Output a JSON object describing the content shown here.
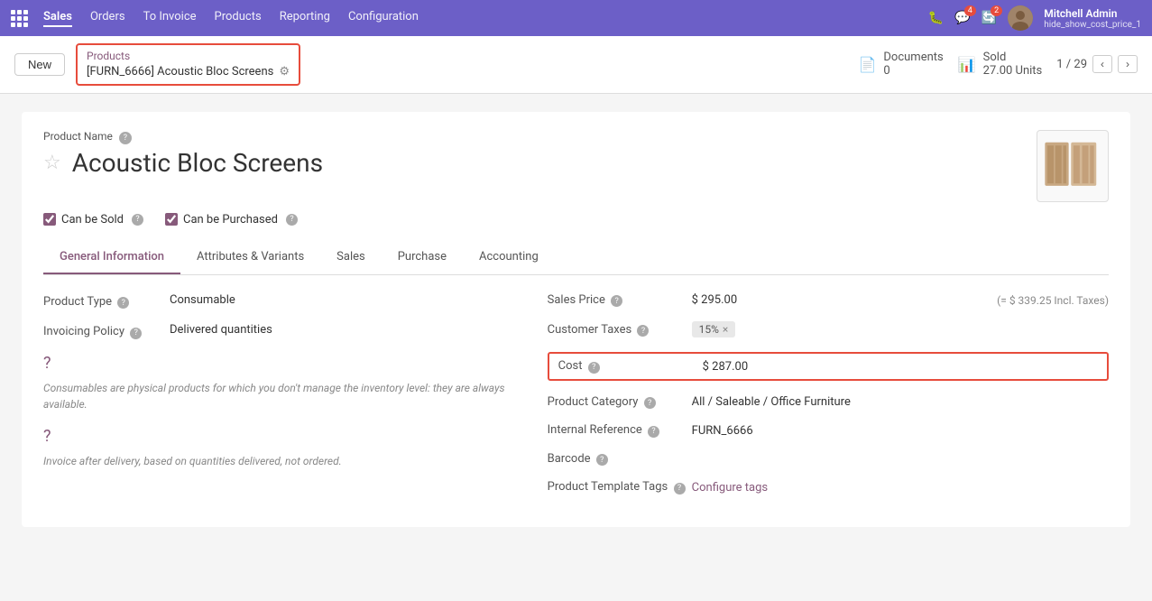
{
  "app": {
    "title": "Odoo"
  },
  "topnav": {
    "menu_items": [
      {
        "id": "sales",
        "label": "Sales",
        "active": true
      },
      {
        "id": "orders",
        "label": "Orders",
        "active": false
      },
      {
        "id": "to_invoice",
        "label": "To Invoice",
        "active": false
      },
      {
        "id": "products",
        "label": "Products",
        "active": false
      },
      {
        "id": "reporting",
        "label": "Reporting",
        "active": false
      },
      {
        "id": "configuration",
        "label": "Configuration",
        "active": false
      }
    ],
    "notifications_count": "4",
    "activities_count": "2",
    "user_name": "Mitchell Admin",
    "user_sub": "hide_show_cost_price_1"
  },
  "subheader": {
    "new_label": "New",
    "breadcrumb_parent": "Products",
    "breadcrumb_current": "[FURN_6666] Acoustic Bloc Screens",
    "documents_label": "Documents",
    "documents_count": "0",
    "sold_label": "Sold",
    "sold_value": "27.00 Units",
    "pagination": "1 / 29"
  },
  "product": {
    "name_label": "Product Name",
    "title": "Acoustic Bloc Screens",
    "can_be_sold": true,
    "can_be_sold_label": "Can be Sold",
    "can_be_purchased": true,
    "can_be_purchased_label": "Can be Purchased"
  },
  "tabs": [
    {
      "id": "general",
      "label": "General Information",
      "active": true
    },
    {
      "id": "attributes",
      "label": "Attributes & Variants",
      "active": false
    },
    {
      "id": "sales",
      "label": "Sales",
      "active": false
    },
    {
      "id": "purchase",
      "label": "Purchase",
      "active": false
    },
    {
      "id": "accounting",
      "label": "Accounting",
      "active": false
    }
  ],
  "general_info": {
    "left": {
      "product_type_label": "Product Type",
      "product_type_value": "Consumable",
      "invoicing_policy_label": "Invoicing Policy",
      "invoicing_policy_value": "Delivered quantities",
      "help_text_1": "Consumables are physical products for which you don't manage the inventory level: they are always available.",
      "help_text_2": "Invoice after delivery, based on quantities delivered, not ordered."
    },
    "right": {
      "sales_price_label": "Sales Price",
      "sales_price_value": "$ 295.00",
      "sales_price_incl": "(= $ 339.25 Incl. Taxes)",
      "customer_taxes_label": "Customer Taxes",
      "customer_taxes_value": "15%",
      "cost_label": "Cost",
      "cost_value": "$ 287.00",
      "product_category_label": "Product Category",
      "product_category_value": "All / Saleable / Office Furniture",
      "internal_reference_label": "Internal Reference",
      "internal_reference_value": "FURN_6666",
      "barcode_label": "Barcode",
      "barcode_value": "",
      "product_template_tags_label": "Product Template Tags",
      "configure_tags_label": "Configure tags"
    }
  }
}
